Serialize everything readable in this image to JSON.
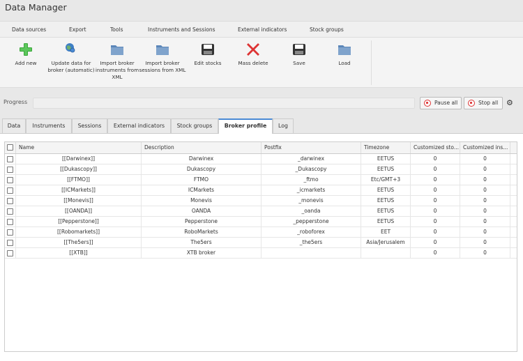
{
  "app": {
    "title": "Data Manager"
  },
  "menu": [
    "Data sources",
    "Export",
    "Tools",
    "Instruments and Sessions",
    "External indicators",
    "Stock groups"
  ],
  "toolbar": [
    {
      "label": "Add new",
      "icon": "plus-icon"
    },
    {
      "label": "Update data for broker (automatic)",
      "icon": "globe-icon"
    },
    {
      "label": "Import broker instruments from XML",
      "icon": "folder-icon"
    },
    {
      "label": "Import broker sessions from XML",
      "icon": "folder-icon"
    },
    {
      "label": "Edit stocks",
      "icon": "floppy-icon"
    },
    {
      "label": "Mass delete",
      "icon": "red-x-icon"
    },
    {
      "label": "Save",
      "icon": "floppy-icon"
    },
    {
      "label": "Load",
      "icon": "folder-icon"
    }
  ],
  "progress": {
    "label": "Progress",
    "pause_label": "Pause all",
    "stop_label": "Stop all"
  },
  "tabs": [
    "Data",
    "Instruments",
    "Sessions",
    "External indicators",
    "Stock groups",
    "Broker profile",
    "Log"
  ],
  "active_tab": "Broker profile",
  "table": {
    "columns": [
      "Name",
      "Description",
      "Postfix",
      "Timezone",
      "Customized sto...",
      "Customized ins..."
    ],
    "rows": [
      {
        "name": "[[Darwinex]]",
        "description": "Darwinex",
        "postfix": "_darwinex",
        "timezone": "EETUS",
        "stocks": "0",
        "instruments": "0"
      },
      {
        "name": "[[Dukascopy]]",
        "description": "Dukascopy",
        "postfix": "_Dukascopy",
        "timezone": "EETUS",
        "stocks": "0",
        "instruments": "0"
      },
      {
        "name": "[[FTMO]]",
        "description": "FTMO",
        "postfix": "_ftmo",
        "timezone": "Etc/GMT+3",
        "stocks": "0",
        "instruments": "0"
      },
      {
        "name": "[[ICMarkets]]",
        "description": "ICMarkets",
        "postfix": "_icmarkets",
        "timezone": "EETUS",
        "stocks": "0",
        "instruments": "0"
      },
      {
        "name": "[[Monevis]]",
        "description": "Monevis",
        "postfix": "_monevis",
        "timezone": "EETUS",
        "stocks": "0",
        "instruments": "0"
      },
      {
        "name": "[[OANDA]]",
        "description": "OANDA",
        "postfix": "_oanda",
        "timezone": "EETUS",
        "stocks": "0",
        "instruments": "0"
      },
      {
        "name": "[[Pepperstone]]",
        "description": "Pepperstone",
        "postfix": "_pepperstone",
        "timezone": "EETUS",
        "stocks": "0",
        "instruments": "0"
      },
      {
        "name": "[[Robomarkets]]",
        "description": "RoboMarkets",
        "postfix": "_roboforex",
        "timezone": "EET",
        "stocks": "0",
        "instruments": "0"
      },
      {
        "name": "[[The5ers]]",
        "description": "The5ers",
        "postfix": "_the5ers",
        "timezone": "Asia/Jerusalem",
        "stocks": "0",
        "instruments": "0"
      },
      {
        "name": "[[XTB]]",
        "description": "XTB broker",
        "postfix": "",
        "timezone": "",
        "stocks": "0",
        "instruments": "0"
      }
    ]
  },
  "colors": {
    "accent": "#4a8ad4",
    "stop": "#dd3333",
    "add": "#3aa83a"
  }
}
